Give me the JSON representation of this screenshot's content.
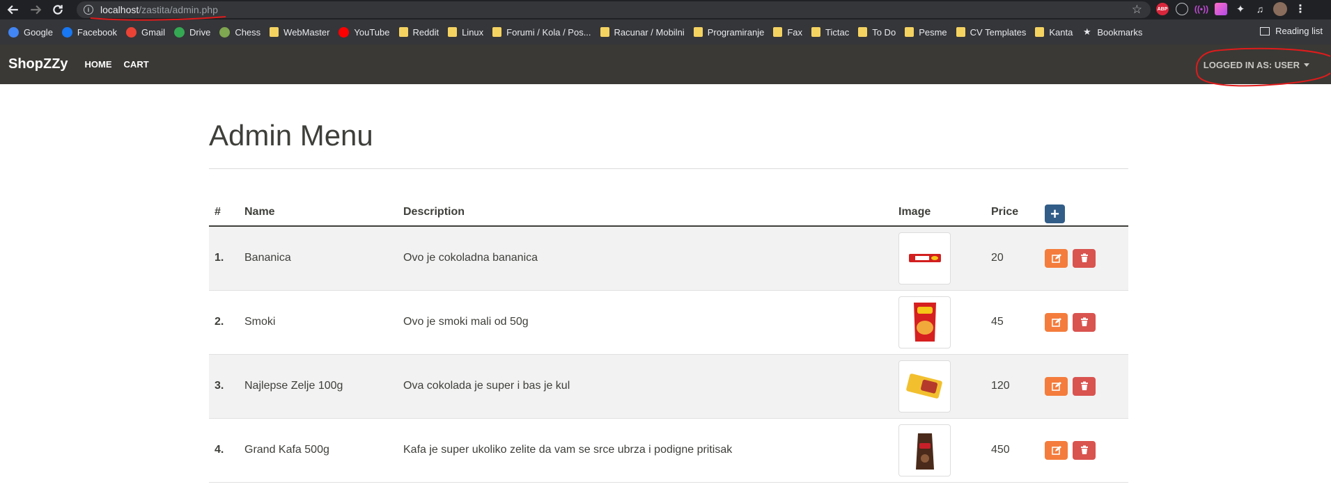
{
  "browser": {
    "url_host": "localhost",
    "url_path": "/zastita/admin.php",
    "bookmarks": [
      {
        "label": "Google",
        "icon": "google-icon",
        "color": "#4285f4"
      },
      {
        "label": "Facebook",
        "icon": "facebook-icon",
        "color": "#1877f2"
      },
      {
        "label": "Gmail",
        "icon": "gmail-icon",
        "color": "#ea4335"
      },
      {
        "label": "Drive",
        "icon": "drive-icon",
        "color": "#34a853"
      },
      {
        "label": "Chess",
        "icon": "chess-icon",
        "color": "#7fa650"
      },
      {
        "label": "WebMaster",
        "icon": "folder-icon"
      },
      {
        "label": "YouTube",
        "icon": "youtube-icon",
        "color": "#ff0000"
      },
      {
        "label": "Reddit",
        "icon": "folder-icon"
      },
      {
        "label": "Linux",
        "icon": "folder-icon"
      },
      {
        "label": "Forumi / Kola / Pos...",
        "icon": "folder-icon"
      },
      {
        "label": "Racunar / Mobilni",
        "icon": "folder-icon"
      },
      {
        "label": "Programiranje",
        "icon": "folder-icon"
      },
      {
        "label": "Fax",
        "icon": "folder-icon"
      },
      {
        "label": "Tictac",
        "icon": "folder-icon"
      },
      {
        "label": "To Do",
        "icon": "folder-icon"
      },
      {
        "label": "Pesme",
        "icon": "folder-icon"
      },
      {
        "label": "CV Templates",
        "icon": "folder-icon"
      },
      {
        "label": "Kanta",
        "icon": "folder-icon"
      },
      {
        "label": "Bookmarks",
        "icon": "star-icon"
      }
    ],
    "reading_list_label": "Reading list",
    "extensions": {
      "abp_label": "ABP"
    }
  },
  "navbar": {
    "brand": "ShopZZy",
    "links": [
      "HOME",
      "CART"
    ],
    "user_menu": "LOGGED IN AS: USER"
  },
  "page": {
    "title": "Admin Menu"
  },
  "table": {
    "headers": {
      "num": "#",
      "name": "Name",
      "description": "Description",
      "image": "Image",
      "price": "Price"
    },
    "add_label": "+",
    "rows": [
      {
        "num": "1.",
        "name": "Bananica",
        "description": "Ovo je cokoladna bananica",
        "price": "20",
        "image": "bananica-product-image"
      },
      {
        "num": "2.",
        "name": "Smoki",
        "description": "Ovo je smoki mali od 50g",
        "price": "45",
        "image": "smoki-product-image"
      },
      {
        "num": "3.",
        "name": "Najlepse Zelje 100g",
        "description": "Ova cokolada je super i bas je kul",
        "price": "120",
        "image": "chocolate-product-image"
      },
      {
        "num": "4.",
        "name": "Grand Kafa 500g",
        "description": "Kafa je super ukoliko zelite da vam se srce ubrza i podigne pritisak",
        "price": "450",
        "image": "coffee-product-image"
      }
    ]
  },
  "colors": {
    "navbar_bg": "#3a3935",
    "primary": "#325d88",
    "warning": "#f47c3c",
    "danger": "#d9534f"
  }
}
